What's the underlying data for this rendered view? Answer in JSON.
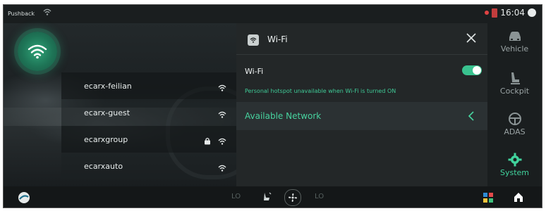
{
  "status": {
    "pushback": "Pushback",
    "time": "16:04"
  },
  "networks": [
    {
      "name": "ecarx-feilian",
      "locked": false
    },
    {
      "name": "ecarx-guest",
      "locked": false
    },
    {
      "name": "ecarxgroup",
      "locked": true
    },
    {
      "name": "ecarxauto",
      "locked": false
    }
  ],
  "panel": {
    "title": "Wi-Fi",
    "wifi_label": "Wi-Fi",
    "wifi_enabled": true,
    "hint": "Personal hotspot unavailable when Wi-Fi is turned ON",
    "available_label": "Available Network"
  },
  "nav": {
    "vehicle": "Vehicle",
    "cockpit": "Cockpit",
    "adas": "ADAS",
    "system": "System"
  },
  "climate": {
    "left_temp": "LO",
    "right_temp": "LO"
  },
  "colors": {
    "accent": "#41d39d",
    "toggle_on": "#39c28f",
    "panel_bg": "#232728"
  }
}
